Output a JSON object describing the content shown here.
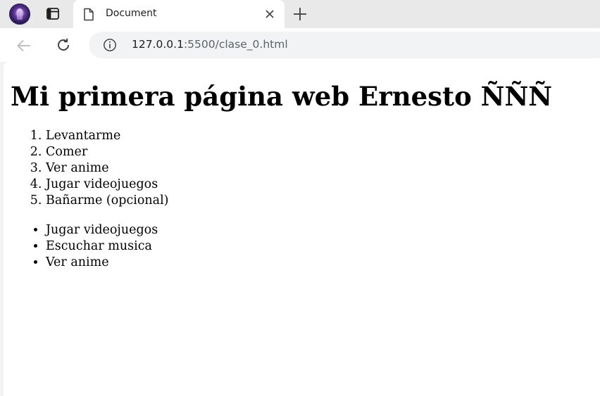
{
  "browser": {
    "tab": {
      "title": "Document",
      "icon": "document-icon"
    },
    "address_bar": {
      "host": "127.0.0.1",
      "path": ":5500/clase_0.html"
    }
  },
  "page": {
    "heading": "Mi primera página web Ernesto ÑÑÑ",
    "ordered_list": [
      "Levantarme",
      "Comer",
      "Ver anime",
      "Jugar videojuegos",
      "Bañarme (opcional)"
    ],
    "unordered_list": [
      "Jugar videojuegos",
      "Escuchar musica",
      "Ver anime"
    ]
  }
}
